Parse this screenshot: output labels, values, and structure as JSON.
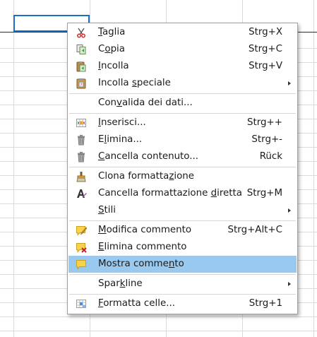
{
  "context_menu": {
    "items": [
      {
        "pre": "",
        "u": "T",
        "post": "aglia",
        "shortcut": "Strg+X",
        "icon": "scissors-icon"
      },
      {
        "pre": "C",
        "u": "o",
        "post": "pia",
        "shortcut": "Strg+C",
        "icon": "copy-icon"
      },
      {
        "pre": "",
        "u": "I",
        "post": "ncolla",
        "shortcut": "Strg+V",
        "icon": "paste-icon"
      },
      {
        "pre": "Incolla ",
        "u": "s",
        "post": "peciale",
        "shortcut": "",
        "icon": "paste-special-icon",
        "submenu": true
      },
      {
        "pre": "Con",
        "u": "v",
        "post": "alida dei dati...",
        "shortcut": "",
        "icon": ""
      },
      {
        "pre": "",
        "u": "I",
        "post": "nserisci...",
        "shortcut": "Strg++",
        "icon": "insert-cells-icon"
      },
      {
        "pre": "E",
        "u": "l",
        "post": "imina...",
        "shortcut": "Strg+-",
        "icon": "trash-icon"
      },
      {
        "pre": "",
        "u": "C",
        "post": "ancella contenuto...",
        "shortcut": "Rück",
        "icon": "trash-icon"
      },
      {
        "pre": "Clona formatta",
        "u": "z",
        "post": "ione",
        "shortcut": "",
        "icon": "clone-formatting-icon"
      },
      {
        "pre": "Cancella formattazione ",
        "u": "d",
        "post": "iretta",
        "shortcut": "Strg+M",
        "icon": "clear-direct-formatting-icon"
      },
      {
        "pre": "",
        "u": "S",
        "post": "tili",
        "shortcut": "",
        "icon": "",
        "submenu": true
      },
      {
        "pre": "",
        "u": "M",
        "post": "odifica commento",
        "shortcut": "Strg+Alt+C",
        "icon": "edit-comment-icon"
      },
      {
        "pre": "",
        "u": "E",
        "post": "limina commento",
        "shortcut": "",
        "icon": "delete-comment-icon"
      },
      {
        "pre": "Mostra comme",
        "u": "n",
        "post": "to",
        "shortcut": "",
        "icon": "show-comment-icon",
        "highlighted": true
      },
      {
        "pre": "Spar",
        "u": "k",
        "post": "line",
        "shortcut": "",
        "icon": "",
        "submenu": true
      },
      {
        "pre": "",
        "u": "F",
        "post": "ormatta celle...",
        "shortcut": "Strg+1",
        "icon": "format-cells-icon"
      }
    ]
  },
  "colors": {
    "highlight": "#99c9ef",
    "selected_cell_border": "#1a6fc6",
    "grid_line": "#dadada",
    "menu_border": "#a0a0a0"
  }
}
